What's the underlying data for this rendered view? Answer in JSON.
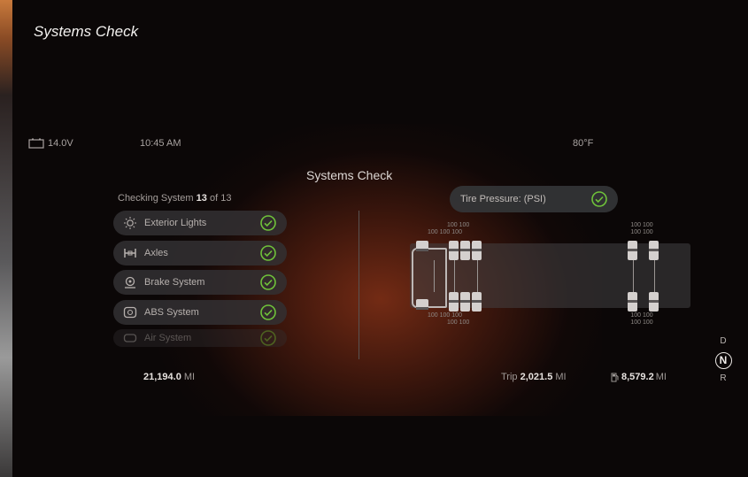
{
  "caption": "Systems Check",
  "status_bar": {
    "battery_voltage": "14.0V",
    "time": "10:45 AM",
    "temperature": "80°F"
  },
  "screen_title": "Systems Check",
  "checking": {
    "prefix": "Checking System",
    "current": "13",
    "of_label": "of",
    "total": "13"
  },
  "systems": [
    {
      "label": "Exterior Lights",
      "icon": "exterior-lights-icon",
      "status": "ok"
    },
    {
      "label": "Axles",
      "icon": "axle-icon",
      "status": "ok"
    },
    {
      "label": "Brake System",
      "icon": "brake-icon",
      "status": "ok"
    },
    {
      "label": "ABS System",
      "icon": "abs-icon",
      "status": "ok"
    },
    {
      "label": "Air System",
      "icon": "air-system-icon",
      "status": "ok"
    }
  ],
  "tire_pressure": {
    "label": "Tire Pressure: (PSI)",
    "status": "ok",
    "front_top_values": [
      "100",
      "100",
      "100",
      "100",
      "100",
      "100"
    ],
    "rear_top_values": [
      "100",
      "100",
      "100",
      "100"
    ],
    "front_bottom_values": [
      "100",
      "100",
      "100",
      "100",
      "100",
      "100"
    ],
    "rear_bottom_values": [
      "100",
      "100",
      "100",
      "100"
    ]
  },
  "odometer": {
    "value": "21,194.0",
    "unit": "MI"
  },
  "trip": {
    "label": "Trip",
    "value": "2,021.5",
    "unit": "MI"
  },
  "fuel_range": {
    "value": "8,579.2",
    "unit": "MI",
    "icon": "fuel-pump-icon"
  },
  "gears": {
    "drive": "D",
    "neutral": "N",
    "reverse": "R",
    "selected": "N"
  },
  "colors": {
    "ok_green": "#6fc23a",
    "background": "#0b0707",
    "glow": "#96371a"
  }
}
